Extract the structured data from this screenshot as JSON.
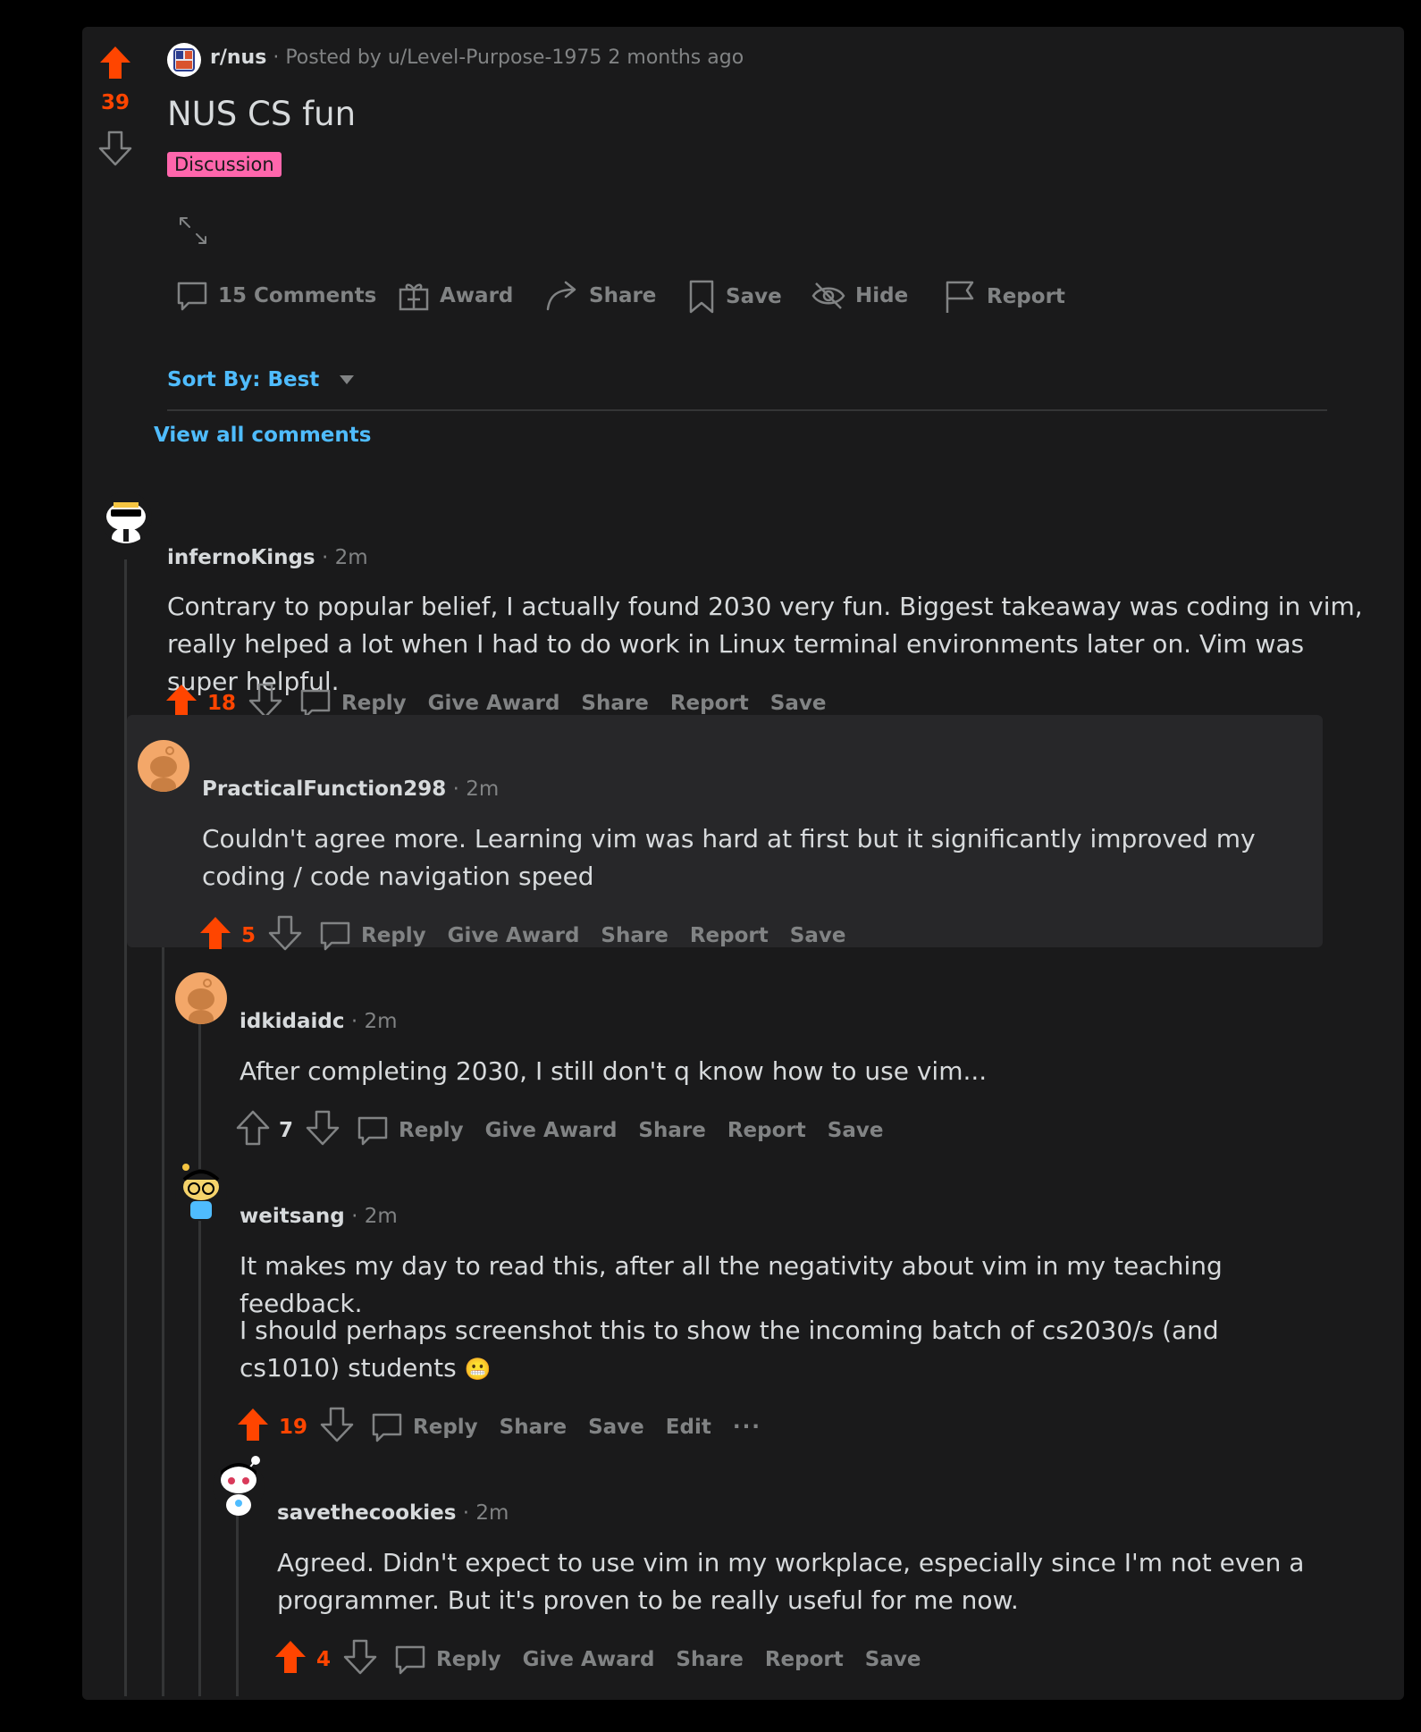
{
  "post": {
    "subreddit": "r/nus",
    "posted_by": "Posted by u/Level-Purpose-1975",
    "time": "2 months ago",
    "title": "NUS CS fun",
    "flair": "Discussion",
    "score": "39",
    "actions": {
      "comments": "15 Comments",
      "award": "Award",
      "share": "Share",
      "save": "Save",
      "hide": "Hide",
      "report": "Report"
    }
  },
  "sort": {
    "label": "Sort By: Best"
  },
  "view_all": "View all comments",
  "comments": [
    {
      "author": "infernoKings",
      "time": "2m",
      "body": "Contrary to popular belief, I actually found 2030 very fun. Biggest takeaway was coding in vim, really helped a lot when I had to do work in Linux terminal environments later on. Vim was super helpful.",
      "score": "18",
      "actions": [
        "Reply",
        "Give Award",
        "Share",
        "Report",
        "Save"
      ]
    },
    {
      "author": "PracticalFunction298",
      "time": "2m",
      "body": "Couldn't agree more. Learning vim was hard at first but it significantly improved my coding / code navigation speed",
      "score": "5",
      "actions": [
        "Reply",
        "Give Award",
        "Share",
        "Report",
        "Save"
      ]
    },
    {
      "author": "idkidaidc",
      "time": "2m",
      "body": "After completing 2030, I still don't q know how to use vim...",
      "score": "7",
      "actions": [
        "Reply",
        "Give Award",
        "Share",
        "Report",
        "Save"
      ]
    },
    {
      "author": "weitsang",
      "time": "2m",
      "body_p1": "It makes my day to read this, after all the negativity about vim in my teaching feedback.",
      "body_p2": "I should perhaps screenshot this to show the incoming batch of cs2030/s (and cs1010) students",
      "emoji": "😬",
      "score": "19",
      "actions": [
        "Reply",
        "Share",
        "Save",
        "Edit"
      ],
      "more": "···"
    },
    {
      "author": "savethecookies",
      "time": "2m",
      "body": "Agreed. Didn't expect to use vim in my workplace, especially since I'm not even a programmer. But it's proven to be really useful for me now.",
      "score": "4",
      "actions": [
        "Reply",
        "Give Award",
        "Share",
        "Report",
        "Save"
      ]
    }
  ],
  "icons": {
    "upvote": "upvote-arrow-icon",
    "downvote": "downvote-arrow-icon",
    "comment": "comment-bubble-icon",
    "award": "gift-icon",
    "share": "share-arrow-icon",
    "save": "bookmark-icon",
    "hide": "eye-slash-icon",
    "report": "flag-icon",
    "expand": "expand-arrows-icon",
    "caret": "caret-down-icon"
  },
  "colors": {
    "background": "#000000",
    "card": "#1a1a1b",
    "upvote": "#ff4500",
    "flair": "#ff66ac",
    "link": "#4fbcff",
    "muted": "#818384",
    "text": "#d7dadc",
    "highlight": "#272729"
  }
}
